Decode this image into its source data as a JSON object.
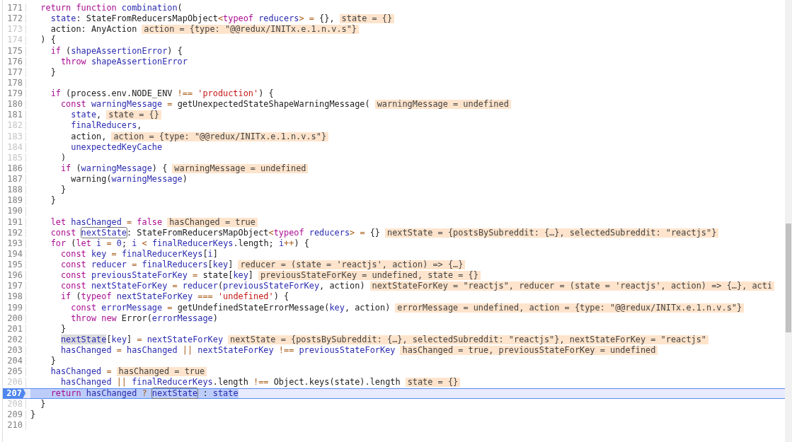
{
  "editor": {
    "lines": [
      {
        "number": "171",
        "dimmed": false,
        "current": false,
        "tokens": [
          {
            "kind": "keyword",
            "text": "  return function "
          },
          {
            "kind": "variable",
            "text": "combination"
          },
          {
            "kind": "plain",
            "text": "("
          }
        ]
      },
      {
        "number": "172",
        "dimmed": false,
        "current": false,
        "tokens": [
          {
            "kind": "variable",
            "text": "    state"
          },
          {
            "kind": "plain",
            "text": ": StateFromReducersMapObject"
          },
          {
            "kind": "operator",
            "text": "<"
          },
          {
            "kind": "keyword",
            "text": "typeof "
          },
          {
            "kind": "variable",
            "text": "reducers"
          },
          {
            "kind": "operator",
            "text": "> = "
          },
          {
            "kind": "plain",
            "text": "{},"
          }
        ],
        "value": "state = {}"
      },
      {
        "number": "173",
        "dimmed": true,
        "current": false,
        "tokens": [
          {
            "kind": "plain",
            "text": "    action: AnyAction"
          }
        ],
        "value": "action = {type: \"@@redux/INITx.e.1.n.v.s\"}"
      },
      {
        "number": "174",
        "dimmed": true,
        "current": false,
        "tokens": [
          {
            "kind": "plain",
            "text": "  ) {"
          }
        ]
      },
      {
        "number": "175",
        "dimmed": false,
        "current": false,
        "tokens": [
          {
            "kind": "keyword",
            "text": "    if"
          },
          {
            "kind": "plain",
            "text": " ("
          },
          {
            "kind": "variable",
            "text": "shapeAssertionError"
          },
          {
            "kind": "plain",
            "text": ") {"
          }
        ]
      },
      {
        "number": "176",
        "dimmed": false,
        "current": false,
        "tokens": [
          {
            "kind": "keyword",
            "text": "      throw "
          },
          {
            "kind": "variable",
            "text": "shapeAssertionError"
          }
        ]
      },
      {
        "number": "177",
        "dimmed": false,
        "current": false,
        "tokens": [
          {
            "kind": "plain",
            "text": "    }"
          }
        ]
      },
      {
        "number": "178",
        "dimmed": false,
        "current": false
      },
      {
        "number": "179",
        "dimmed": false,
        "current": false,
        "tokens": [
          {
            "kind": "keyword",
            "text": "    if"
          },
          {
            "kind": "plain",
            "text": " (process.env.NODE_ENV "
          },
          {
            "kind": "operator",
            "text": "!== "
          },
          {
            "kind": "string",
            "text": "'production'"
          },
          {
            "kind": "plain",
            "text": ") {"
          }
        ]
      },
      {
        "number": "180",
        "dimmed": false,
        "current": false,
        "tokens": [
          {
            "kind": "keyword",
            "text": "      const "
          },
          {
            "kind": "variable",
            "text": "warningMessage "
          },
          {
            "kind": "operator",
            "text": "= "
          },
          {
            "kind": "plain",
            "text": "getUnexpectedStateShapeWarningMessage("
          }
        ],
        "value": "warningMessage = undefined"
      },
      {
        "number": "181",
        "dimmed": false,
        "current": false,
        "tokens": [
          {
            "kind": "variable",
            "text": "        state"
          },
          {
            "kind": "plain",
            "text": ","
          }
        ],
        "value": "state = {}"
      },
      {
        "number": "182",
        "dimmed": true,
        "current": false,
        "tokens": [
          {
            "kind": "variable",
            "text": "        finalReducers"
          },
          {
            "kind": "plain",
            "text": ","
          }
        ]
      },
      {
        "number": "183",
        "dimmed": true,
        "current": false,
        "tokens": [
          {
            "kind": "plain",
            "text": "        action,"
          }
        ],
        "value": "action = {type: \"@@redux/INITx.e.1.n.v.s\"}"
      },
      {
        "number": "184",
        "dimmed": true,
        "current": false,
        "tokens": [
          {
            "kind": "variable",
            "text": "        unexpectedKeyCache"
          }
        ]
      },
      {
        "number": "185",
        "dimmed": true,
        "current": false,
        "tokens": [
          {
            "kind": "plain",
            "text": "      )"
          }
        ]
      },
      {
        "number": "186",
        "dimmed": false,
        "current": false,
        "tokens": [
          {
            "kind": "keyword",
            "text": "      if"
          },
          {
            "kind": "plain",
            "text": " ("
          },
          {
            "kind": "variable",
            "text": "warningMessage"
          },
          {
            "kind": "plain",
            "text": ") {"
          }
        ],
        "value": "warningMessage = undefined"
      },
      {
        "number": "187",
        "dimmed": false,
        "current": false,
        "tokens": [
          {
            "kind": "plain",
            "text": "        warning("
          },
          {
            "kind": "variable",
            "text": "warningMessage"
          },
          {
            "kind": "plain",
            "text": ")"
          }
        ]
      },
      {
        "number": "188",
        "dimmed": false,
        "current": false,
        "tokens": [
          {
            "kind": "plain",
            "text": "      }"
          }
        ]
      },
      {
        "number": "189",
        "dimmed": false,
        "current": false,
        "tokens": [
          {
            "kind": "plain",
            "text": "    }"
          }
        ]
      },
      {
        "number": "190",
        "dimmed": false,
        "current": false
      },
      {
        "number": "191",
        "dimmed": false,
        "current": false,
        "tokens": [
          {
            "kind": "keyword",
            "text": "    let "
          },
          {
            "kind": "variable",
            "text": "hasChanged "
          },
          {
            "kind": "operator",
            "text": "= "
          },
          {
            "kind": "keyword",
            "text": "false"
          }
        ],
        "value": "hasChanged = true"
      },
      {
        "number": "192",
        "dimmed": false,
        "current": false,
        "tokens": [
          {
            "kind": "keyword",
            "text": "    const "
          },
          {
            "kind": "outlined",
            "text": "nextState"
          },
          {
            "kind": "plain",
            "text": ": StateFromReducersMapObject"
          },
          {
            "kind": "operator",
            "text": "<"
          },
          {
            "kind": "keyword",
            "text": "typeof "
          },
          {
            "kind": "variable",
            "text": "reducers"
          },
          {
            "kind": "operator",
            "text": "> = "
          },
          {
            "kind": "plain",
            "text": "{}"
          }
        ],
        "value": "nextState = {postsBySubreddit: {…}, selectedSubreddit: \"reactjs\"}"
      },
      {
        "number": "193",
        "dimmed": false,
        "current": false,
        "tokens": [
          {
            "kind": "keyword",
            "text": "    for"
          },
          {
            "kind": "plain",
            "text": " ("
          },
          {
            "kind": "keyword",
            "text": "let "
          },
          {
            "kind": "variable",
            "text": "i "
          },
          {
            "kind": "operator",
            "text": "= "
          },
          {
            "kind": "number",
            "text": "0"
          },
          {
            "kind": "plain",
            "text": "; "
          },
          {
            "kind": "variable",
            "text": "i "
          },
          {
            "kind": "operator",
            "text": "< "
          },
          {
            "kind": "variable",
            "text": "finalReducerKeys"
          },
          {
            "kind": "plain",
            "text": ".length; "
          },
          {
            "kind": "variable",
            "text": "i"
          },
          {
            "kind": "operator",
            "text": "++"
          },
          {
            "kind": "plain",
            "text": ") {"
          }
        ]
      },
      {
        "number": "194",
        "dimmed": false,
        "current": false,
        "tokens": [
          {
            "kind": "keyword",
            "text": "      const "
          },
          {
            "kind": "variable",
            "text": "key "
          },
          {
            "kind": "operator",
            "text": "= "
          },
          {
            "kind": "variable",
            "text": "finalReducerKeys"
          },
          {
            "kind": "plain",
            "text": "["
          },
          {
            "kind": "variable",
            "text": "i"
          },
          {
            "kind": "plain",
            "text": "]"
          }
        ]
      },
      {
        "number": "195",
        "dimmed": false,
        "current": false,
        "tokens": [
          {
            "kind": "keyword",
            "text": "      const "
          },
          {
            "kind": "variable",
            "text": "reducer "
          },
          {
            "kind": "operator",
            "text": "= "
          },
          {
            "kind": "variable",
            "text": "finalReducers"
          },
          {
            "kind": "plain",
            "text": "["
          },
          {
            "kind": "variable",
            "text": "key"
          },
          {
            "kind": "plain",
            "text": "]"
          }
        ],
        "value": "reducer = (state = 'reactjs', action) => {…}"
      },
      {
        "number": "196",
        "dimmed": false,
        "current": false,
        "tokens": [
          {
            "kind": "keyword",
            "text": "      const "
          },
          {
            "kind": "variable",
            "text": "previousStateForKey "
          },
          {
            "kind": "operator",
            "text": "= "
          },
          {
            "kind": "plain",
            "text": "state["
          },
          {
            "kind": "variable",
            "text": "key"
          },
          {
            "kind": "plain",
            "text": "]"
          }
        ],
        "value": "previousStateForKey = undefined, state = {}"
      },
      {
        "number": "197",
        "dimmed": false,
        "current": false,
        "tokens": [
          {
            "kind": "keyword",
            "text": "      const "
          },
          {
            "kind": "variable",
            "text": "nextStateForKey "
          },
          {
            "kind": "operator",
            "text": "= "
          },
          {
            "kind": "variable",
            "text": "reducer"
          },
          {
            "kind": "plain",
            "text": "("
          },
          {
            "kind": "variable",
            "text": "previousStateForKey"
          },
          {
            "kind": "plain",
            "text": ", action)"
          }
        ],
        "value": "nextStateForKey = \"reactjs\", reducer = (state = 'reactjs', action) => {…}, acti"
      },
      {
        "number": "198",
        "dimmed": false,
        "current": false,
        "tokens": [
          {
            "kind": "keyword",
            "text": "      if"
          },
          {
            "kind": "plain",
            "text": " ("
          },
          {
            "kind": "keyword",
            "text": "typeof "
          },
          {
            "kind": "variable",
            "text": "nextStateForKey "
          },
          {
            "kind": "operator",
            "text": "=== "
          },
          {
            "kind": "string",
            "text": "'undefined'"
          },
          {
            "kind": "plain",
            "text": ") {"
          }
        ]
      },
      {
        "number": "199",
        "dimmed": false,
        "current": false,
        "tokens": [
          {
            "kind": "keyword",
            "text": "        const "
          },
          {
            "kind": "variable",
            "text": "errorMessage "
          },
          {
            "kind": "operator",
            "text": "= "
          },
          {
            "kind": "plain",
            "text": "getUndefinedStateErrorMessage("
          },
          {
            "kind": "variable",
            "text": "key"
          },
          {
            "kind": "plain",
            "text": ", action)"
          }
        ],
        "value": "errorMessage = undefined, action = {type: \"@@redux/INITx.e.1.n.v.s\"}"
      },
      {
        "number": "200",
        "dimmed": false,
        "current": false,
        "tokens": [
          {
            "kind": "keyword",
            "text": "        throw new "
          },
          {
            "kind": "plain",
            "text": "Error("
          },
          {
            "kind": "variable",
            "text": "errorMessage"
          },
          {
            "kind": "plain",
            "text": ")"
          }
        ]
      },
      {
        "number": "201",
        "dimmed": false,
        "current": false,
        "tokens": [
          {
            "kind": "plain",
            "text": "      }"
          }
        ]
      },
      {
        "number": "202",
        "dimmed": false,
        "current": false,
        "tokens": [
          {
            "kind": "shaded",
            "text": "      nextState"
          },
          {
            "kind": "plain",
            "text": "["
          },
          {
            "kind": "variable",
            "text": "key"
          },
          {
            "kind": "plain",
            "text": "] "
          },
          {
            "kind": "operator",
            "text": "= "
          },
          {
            "kind": "variable",
            "text": "nextStateForKey"
          }
        ],
        "value": "nextState = {postsBySubreddit: {…}, selectedSubreddit: \"reactjs\"}, nextStateForKey = \"reactjs\""
      },
      {
        "number": "203",
        "dimmed": false,
        "current": false,
        "tokens": [
          {
            "kind": "variable",
            "text": "      hasChanged "
          },
          {
            "kind": "operator",
            "text": "= "
          },
          {
            "kind": "variable",
            "text": "hasChanged "
          },
          {
            "kind": "operator",
            "text": "|| "
          },
          {
            "kind": "variable",
            "text": "nextStateForKey "
          },
          {
            "kind": "operator",
            "text": "!== "
          },
          {
            "kind": "variable",
            "text": "previousStateForKey"
          }
        ],
        "value": "hasChanged = true, previousStateForKey = undefined"
      },
      {
        "number": "204",
        "dimmed": false,
        "current": false,
        "tokens": [
          {
            "kind": "plain",
            "text": "    }"
          }
        ]
      },
      {
        "number": "205",
        "dimmed": false,
        "current": false,
        "tokens": [
          {
            "kind": "variable",
            "text": "    hasChanged "
          },
          {
            "kind": "operator",
            "text": "="
          }
        ],
        "value": "hasChanged = true"
      },
      {
        "number": "206",
        "dimmed": true,
        "current": false,
        "tokens": [
          {
            "kind": "variable",
            "text": "      hasChanged "
          },
          {
            "kind": "operator",
            "text": "|| "
          },
          {
            "kind": "variable",
            "text": "finalReducerKeys"
          },
          {
            "kind": "plain",
            "text": ".length "
          },
          {
            "kind": "operator",
            "text": "!== "
          },
          {
            "kind": "plain",
            "text": "Object.keys(state).length"
          }
        ],
        "value": "state = {}"
      },
      {
        "number": "207",
        "dimmed": false,
        "current": true,
        "tokens": [
          {
            "kind": "keyword",
            "text": "    return "
          },
          {
            "kind": "variable",
            "text": "hasChanged "
          },
          {
            "kind": "operator",
            "text": "? "
          },
          {
            "kind": "outlined",
            "text": "nextState"
          },
          {
            "kind": "plain",
            "text": " : "
          },
          {
            "kind": "variable",
            "text": "state"
          }
        ]
      },
      {
        "number": "208",
        "dimmed": true,
        "current": false,
        "tokens": [
          {
            "kind": "plain",
            "text": "  }"
          }
        ]
      },
      {
        "number": "209",
        "dimmed": false,
        "current": false,
        "tokens": [
          {
            "kind": "plain",
            "text": "}"
          }
        ]
      },
      {
        "number": "210",
        "dimmed": false,
        "current": false
      }
    ]
  }
}
